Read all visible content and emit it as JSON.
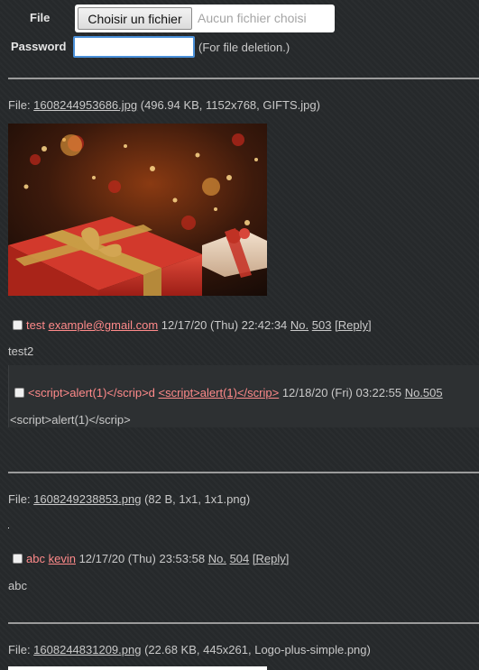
{
  "form": {
    "file_label": "File",
    "file_button": "Choisir un fichier",
    "file_status": "Aucun fichier choisi",
    "password_label": "Password",
    "password_value": "",
    "password_hint": "(For file deletion.)"
  },
  "posts": [
    {
      "file_prefix": "File: ",
      "file_link": "1608244953686.jpg",
      "file_meta": " (496.94 KB, 1152x768, GIFTS.jpg)",
      "name": "test",
      "email": "example@gmail.com",
      "date": "12/17/20 (Thu) 22:42:34",
      "no_label": "No.",
      "no": "503",
      "reply": "[Reply]",
      "message": "test2",
      "replies": [
        {
          "subject": "<script>alert(1)</scrip>d",
          "name": "<script>alert(1)</scrip>",
          "date": "12/18/20 (Fri) 03:22:55",
          "no": "No.505",
          "message": "<script>alert(1)</scrip>"
        }
      ]
    },
    {
      "file_prefix": "File: ",
      "file_link": "1608249238853.png",
      "file_meta": " (82 B, 1x1, 1x1.png)",
      "name": "abc",
      "email": "kevin",
      "date": "12/17/20 (Thu) 23:53:58",
      "no_label": "No.",
      "no": "504",
      "reply": "[Reply]",
      "message": "abc"
    },
    {
      "file_prefix": "File: ",
      "file_link": "1608244831209.png",
      "file_meta": " (22.68 KB, 445x261, Logo-plus-simple.png)"
    }
  ]
}
